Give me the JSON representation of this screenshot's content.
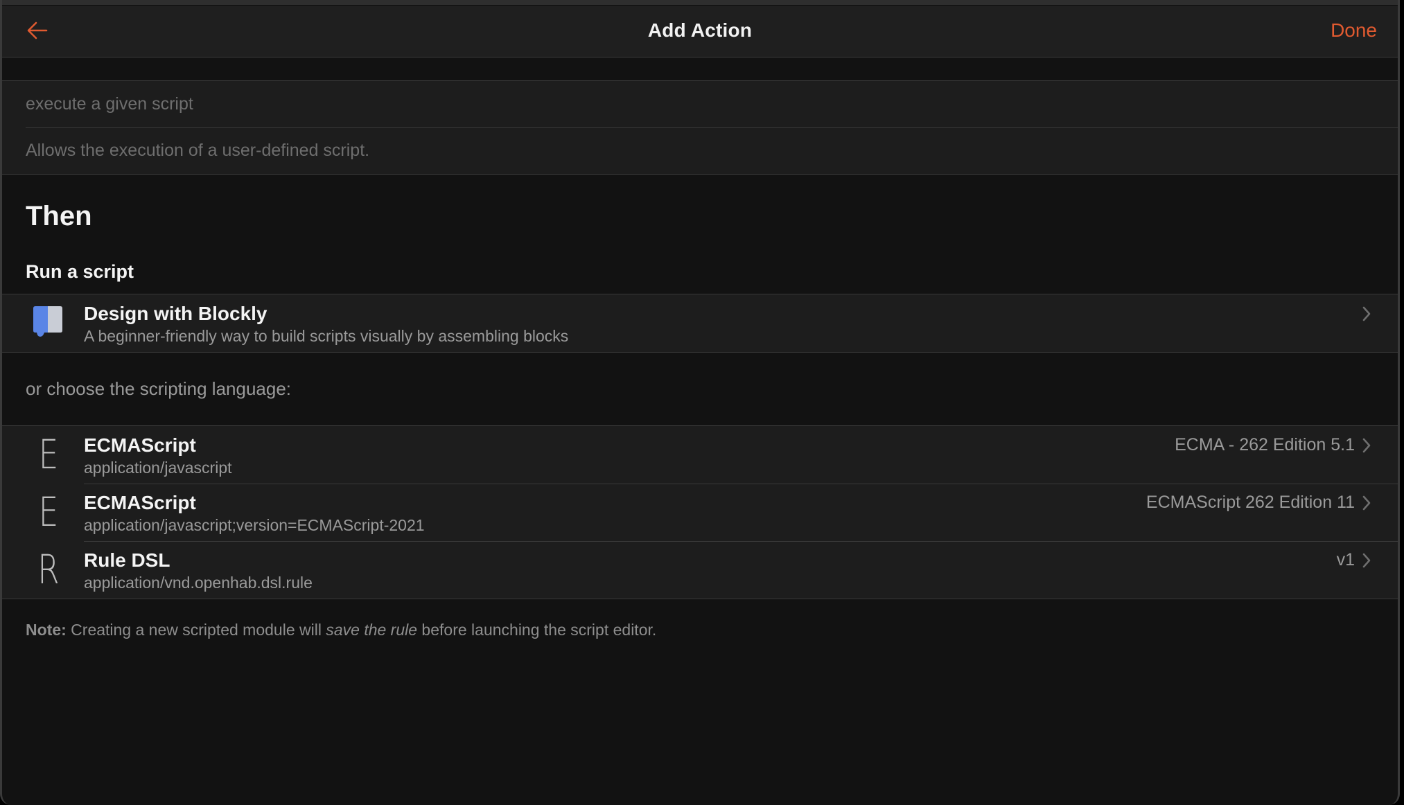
{
  "navbar": {
    "back_icon": "arrow-left-icon",
    "title": "Add Action",
    "done_label": "Done",
    "accent_color": "#e05a30"
  },
  "action_fields": {
    "label_value": "",
    "label_placeholder": "execute a given script",
    "description_value": "",
    "description_placeholder": "Allows the execution of a user-defined script."
  },
  "section": {
    "heading": "Then",
    "subheading": "Run a script"
  },
  "blockly": {
    "icon": "blockly-icon",
    "title": "Design with Blockly",
    "subtitle": "A beginner-friendly way to build scripts visually by assembling blocks"
  },
  "choose_label": "or choose the scripting language:",
  "languages": [
    {
      "letter": "E",
      "title": "ECMAScript",
      "mime": "application/javascript",
      "version": "ECMA - 262 Edition 5.1"
    },
    {
      "letter": "E",
      "title": "ECMAScript",
      "mime": "application/javascript;version=ECMAScript-2021",
      "version": "ECMAScript 262 Edition 11"
    },
    {
      "letter": "R",
      "title": "Rule DSL",
      "mime": "application/vnd.openhab.dsl.rule",
      "version": "v1"
    }
  ],
  "note": {
    "prefix": "Note:",
    "text_before": " Creating a new scripted module will ",
    "emphasis": "save the rule",
    "text_after": " before launching the script editor."
  }
}
